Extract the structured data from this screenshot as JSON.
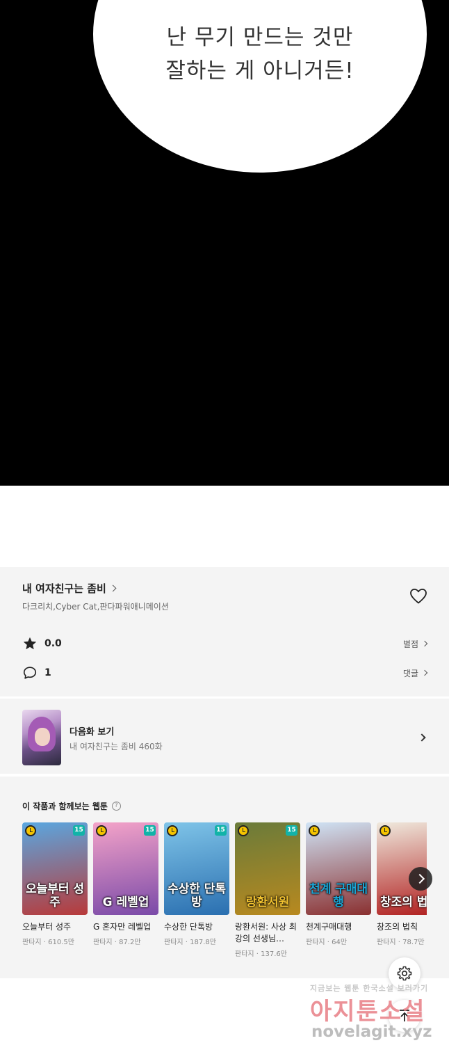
{
  "comic": {
    "speech_line1": "난 무기 만드는 것만",
    "speech_line2": "잘하는 게 아니거든!"
  },
  "series": {
    "title": "내 여자친구는 좀비",
    "authors": "다크리치,Cyber Cat,판다파워애니메이션",
    "rating": "0.0",
    "rating_link": "별점",
    "comments": "1",
    "comments_link": "댓글"
  },
  "next_episode": {
    "label": "다음화 보기",
    "subtitle": "내 여자친구는 좀비 460화"
  },
  "recommendations": {
    "title": "이 작품과 함께보는 웹툰",
    "help_icon": "?",
    "items": [
      {
        "title": "오늘부터 성주",
        "meta": "판타지 · 610.5만",
        "age": "15",
        "cover_text": "오늘부터 성주",
        "colors": [
          "#5aa7e0",
          "#b83a3a"
        ]
      },
      {
        "title": "G 혼자만 레벨업",
        "meta": "판타지 · 87.2만",
        "age": "15",
        "cover_text": "G 레벨업",
        "colors": [
          "#f4a3c8",
          "#7a4aa8"
        ]
      },
      {
        "title": "수상한 단톡방",
        "meta": "판타지 · 187.8만",
        "age": "15",
        "cover_text": "수상한 단톡방",
        "colors": [
          "#7fc4e8",
          "#2a6fb0"
        ]
      },
      {
        "title": "랑환서원: 사상 최강의 선생님…",
        "meta": "판타지 · 137.6만",
        "age": "15",
        "cover_text": "랑환서원",
        "colors": [
          "#6a7b3a",
          "#b8891f"
        ]
      },
      {
        "title": "천계구매대행",
        "meta": "판타지 · 64만",
        "age": "",
        "cover_text": "천계 구매대행",
        "colors": [
          "#cfe3f5",
          "#8a3030"
        ]
      },
      {
        "title": "창조의 법칙",
        "meta": "판타지 · 78.7만",
        "age": "",
        "cover_text": "창조의 법칙",
        "colors": [
          "#efe9dd",
          "#b01e1e"
        ]
      }
    ]
  },
  "watermark": {
    "line1": "지금보는 웹툰 한국소설 보러가기",
    "line2": "아지툰소설",
    "line3": "novelagit.xyz"
  },
  "icons": {
    "heart": "heart-icon",
    "star": "star-icon",
    "comment": "comment-icon",
    "settings": "gear-icon",
    "top": "arrow-up-icon"
  }
}
